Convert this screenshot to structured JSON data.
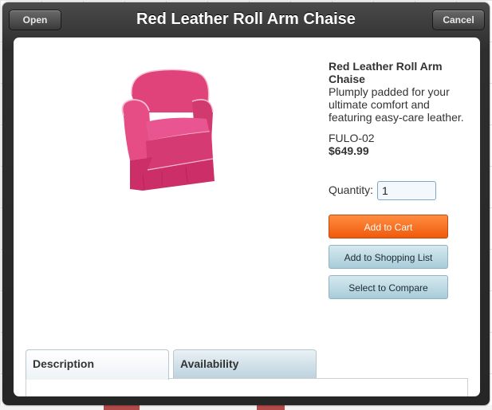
{
  "header": {
    "open_label": "Open",
    "title": "Red Leather Roll Arm Chaise",
    "cancel_label": "Cancel"
  },
  "product": {
    "name": "Red Leather Roll Arm Chaise",
    "description": "Plumply padded for your ultimate comfort and featuring easy-care leather.",
    "sku": "FULO-02",
    "price": "$649.99",
    "image_icon": "armchair-image"
  },
  "quantity": {
    "label": "Quantity:",
    "value": "1"
  },
  "actions": {
    "add_to_cart": "Add to Cart",
    "add_to_shopping_list": "Add to Shopping List",
    "select_to_compare": "Select to Compare"
  },
  "tabs": [
    {
      "label": "Description",
      "active": true
    },
    {
      "label": "Availability",
      "active": false
    }
  ],
  "colors": {
    "primary_action": "#f26b1d",
    "secondary_action": "#b7d6e0",
    "chair": "#e0437a"
  }
}
